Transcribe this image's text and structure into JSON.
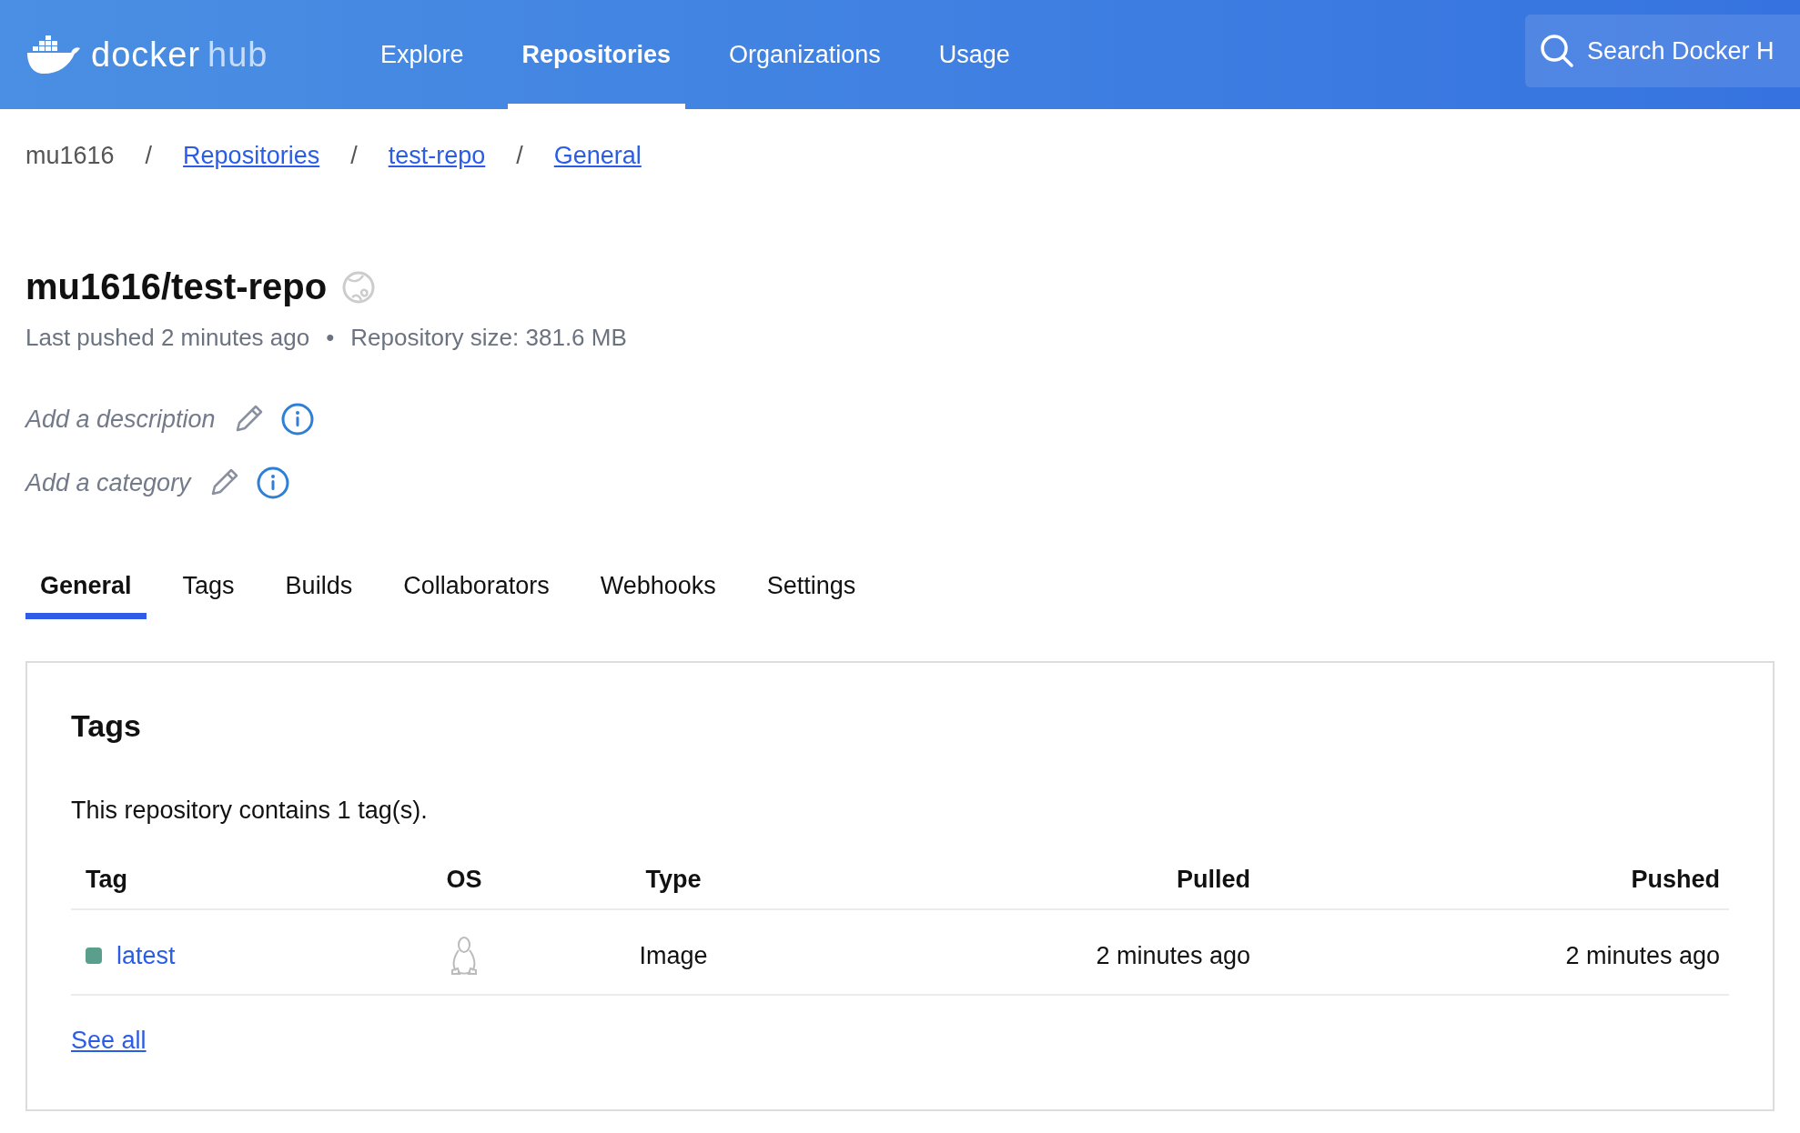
{
  "header": {
    "logo": {
      "part_1": "docker",
      "part_2": "hub"
    },
    "nav": [
      {
        "label": "Explore",
        "selected": false
      },
      {
        "label": "Repositories",
        "selected": true
      },
      {
        "label": "Organizations",
        "selected": false
      },
      {
        "label": "Usage",
        "selected": false
      }
    ],
    "search": {
      "placeholder": "Search Docker H"
    }
  },
  "breadcrumb": [
    {
      "label": "mu1616",
      "link": false
    },
    {
      "label": "Repositories",
      "link": true
    },
    {
      "label": "test-repo",
      "link": true
    },
    {
      "label": "General",
      "link": true
    }
  ],
  "breadcrumb_separator": "/",
  "repo": {
    "title": "mu1616/test-repo",
    "last_pushed": "Last pushed 2 minutes ago",
    "separator": "•",
    "size": "Repository size: 381.6 MB",
    "description_placeholder": "Add a description",
    "category_placeholder": "Add a category"
  },
  "tabs": [
    {
      "label": "General",
      "selected": true
    },
    {
      "label": "Tags",
      "selected": false
    },
    {
      "label": "Builds",
      "selected": false
    },
    {
      "label": "Collaborators",
      "selected": false
    },
    {
      "label": "Webhooks",
      "selected": false
    },
    {
      "label": "Settings",
      "selected": false
    }
  ],
  "tags_card": {
    "title": "Tags",
    "summary": "This repository contains 1 tag(s).",
    "columns": [
      "Tag",
      "OS",
      "Type",
      "Pulled",
      "Pushed"
    ],
    "rows": [
      {
        "tag": "latest",
        "color": "#5a9e8c",
        "type": "Image",
        "pulled": "2 minutes ago",
        "pushed": "2 minutes ago"
      }
    ],
    "see_all": "See all"
  }
}
